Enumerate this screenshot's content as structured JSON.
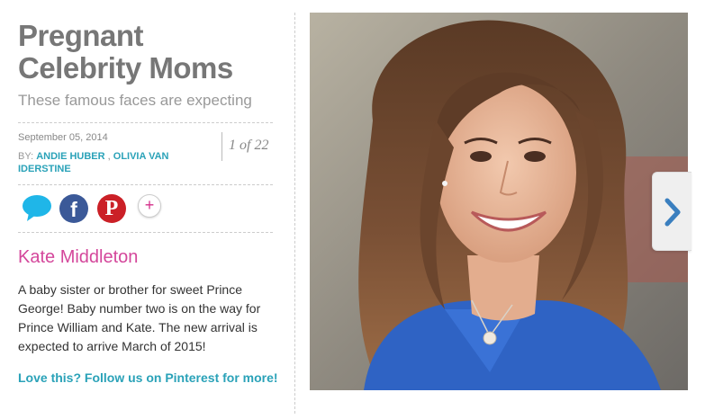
{
  "article": {
    "title": "Pregnant Celebrity Moms",
    "subtitle": "These famous faces are expecting",
    "date": "September 05, 2014",
    "by_label": "BY:",
    "authors": [
      "ANDIE HUBER",
      "OLIVIA VAN IDERSTINE"
    ],
    "author_separator": " , ",
    "counter": "1 of 22"
  },
  "share": {
    "icons": [
      "comment-icon",
      "facebook-icon",
      "pinterest-icon",
      "more-share-icon"
    ],
    "facebook_glyph": "f",
    "pinterest_glyph": "P",
    "more_glyph": "+"
  },
  "slide": {
    "name": "Kate Middleton",
    "caption": "A baby sister or brother for sweet Prince George! Baby number two is on the way for Prince William and Kate. The new arrival is expected to arrive March of 2015!",
    "follow_text": "Love this? Follow us on Pinterest for more!"
  },
  "colors": {
    "title_gray": "#777777",
    "link_teal": "#2aa2b8",
    "name_pink": "#d4479b",
    "facebook_blue": "#3b5998",
    "pinterest_red": "#cb2027",
    "comment_cyan": "#1fb6e8",
    "dress_blue": "#2f63c4"
  },
  "navigation": {
    "next_icon": "chevron-right-icon"
  }
}
